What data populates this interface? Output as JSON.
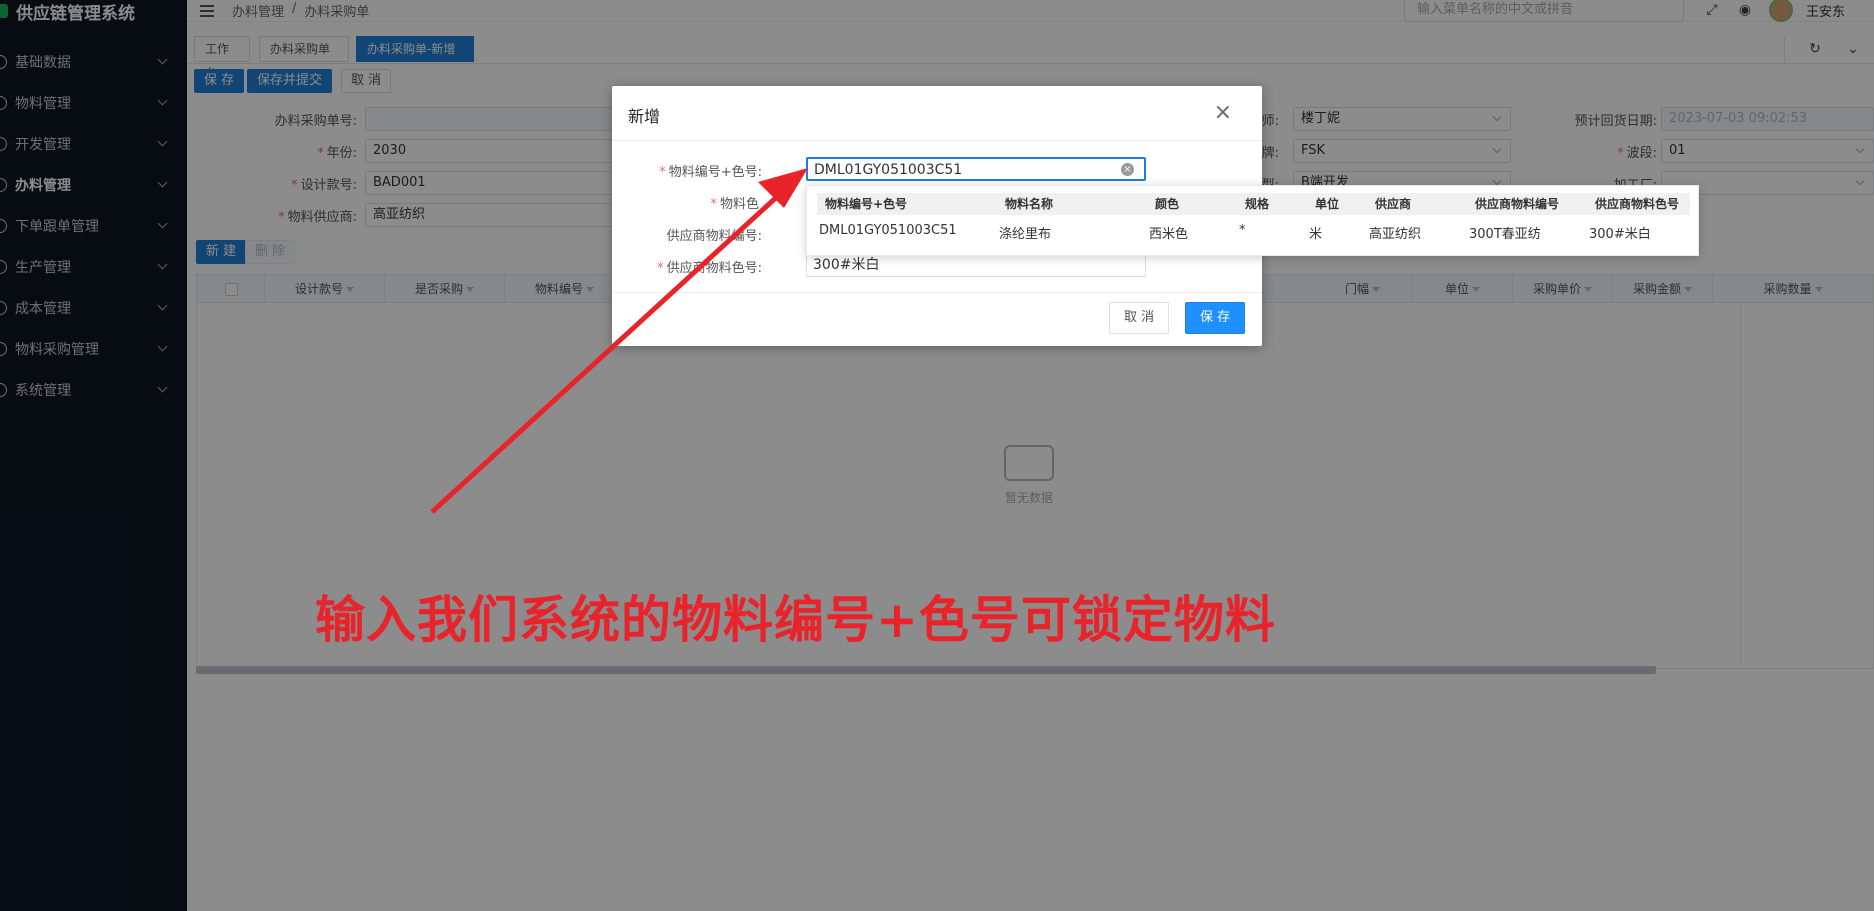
{
  "sidebar": {
    "brand": "供应链管理系统",
    "items": [
      {
        "label": "基础数据"
      },
      {
        "label": "物料管理"
      },
      {
        "label": "开发管理"
      },
      {
        "label": "办料管理"
      },
      {
        "label": "下单跟单管理"
      },
      {
        "label": "生产管理"
      },
      {
        "label": "成本管理"
      },
      {
        "label": "物料采购管理"
      },
      {
        "label": "系统管理"
      }
    ]
  },
  "topbar": {
    "breadcrumb": [
      "办料管理",
      "/",
      "办料采购单"
    ],
    "search_placeholder": "输入菜单名称的中文或拼音",
    "user": "王安东"
  },
  "tabs": [
    {
      "label": "工作台"
    },
    {
      "label": "办料采购单"
    },
    {
      "label": "办料采购单-新增 ×"
    }
  ],
  "toolbar": {
    "save": "保 存",
    "save_submit": "保存并提交",
    "cancel": "取 消"
  },
  "form": {
    "order_no_label": "办料采购单号:",
    "year_label": "年份:",
    "year_value": "2030",
    "design_no_label": "设计款号:",
    "design_no_value": "BAD001",
    "supplier_label": "物料供应商:",
    "supplier_value": "高亚纺织",
    "designer_label": "师:",
    "designer_value": "楼丁妮",
    "brand_label": "牌:",
    "brand_value": "FSK",
    "type_label": "型:",
    "type_value": "B端开发",
    "eta_label": "预计回货日期:",
    "eta_value": "2023-07-03 09:02:53",
    "wave_label": "波段:",
    "wave_value": "01",
    "processor_label": "加工厂:"
  },
  "grid": {
    "new_button": "新 建",
    "delete_button": "删 除",
    "columns": [
      "设计款号",
      "是否采购",
      "物料编号",
      "门幅",
      "单位",
      "采购单价",
      "采购金额",
      "采购数量"
    ],
    "empty_text": "暂无数据"
  },
  "dialog": {
    "title": "新增",
    "field1_label": "物料编号+色号:",
    "field1_value": "DML01GY051003C51",
    "field2_label": "物料色",
    "field3_label": "供应商物料编号:",
    "field4_label": "供应商物料色号:",
    "field4_value": "300#米白",
    "cancel": "取 消",
    "save": "保 存"
  },
  "dropdown": {
    "headers": [
      "物料编号+色号",
      "物料名称",
      "颜色",
      "规格",
      "单位",
      "供应商",
      "供应商物料编号",
      "供应商物料色号"
    ],
    "row": [
      "DML01GY051003C51",
      "涤纶里布",
      "西米色",
      "*",
      "米",
      "高亚纺织",
      "300T春亚纺",
      "300#米白"
    ]
  },
  "annotation": {
    "text": "输入我们系统的物料编号+色号可锁定物料",
    "color": "#e8232a"
  }
}
